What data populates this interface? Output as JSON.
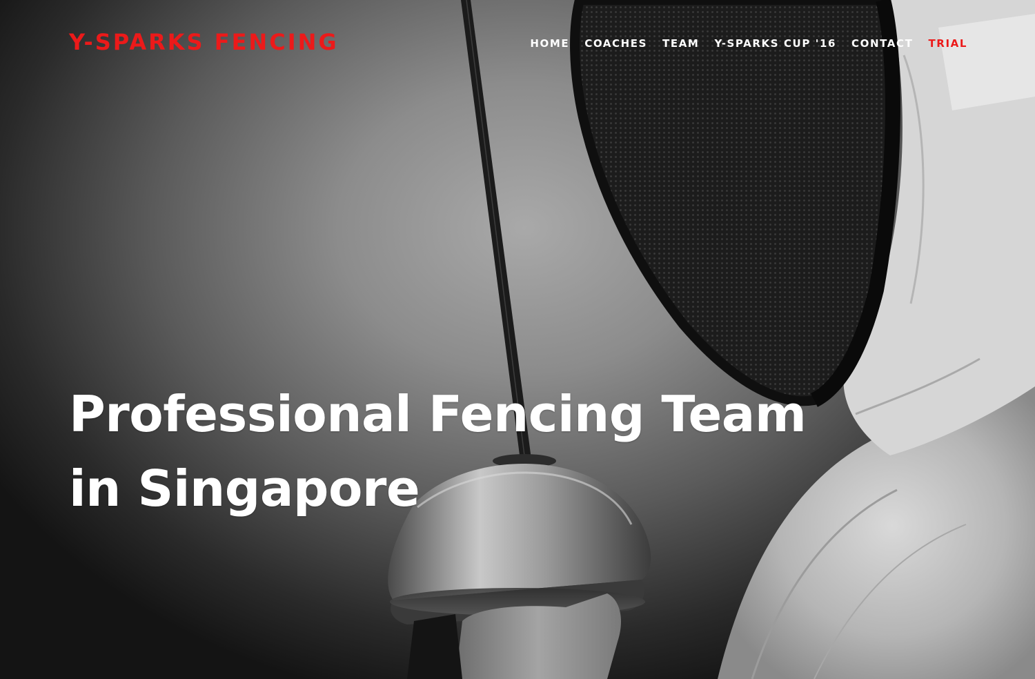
{
  "site": {
    "logo_text": "Y-SPARKS FENCING",
    "brand_color": "#ec1a1a"
  },
  "nav": {
    "items": [
      {
        "label": "HOME",
        "active": false
      },
      {
        "label": "COACHES",
        "active": false
      },
      {
        "label": "TEAM",
        "active": false
      },
      {
        "label": "Y-SPARKS CUP '16",
        "active": false
      },
      {
        "label": "CONTACT",
        "active": false
      },
      {
        "label": "TRIAL",
        "active": true
      }
    ]
  },
  "hero": {
    "headline_line1": "Professional Fencing Team",
    "headline_line2": "in Singapore",
    "image_subject": "fencer-in-mask-holding-epee"
  }
}
